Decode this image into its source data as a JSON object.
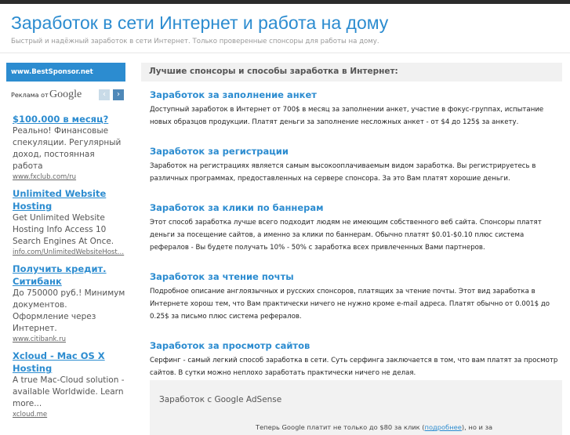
{
  "header": {
    "title": "Заработок в сети Интернет и работа на дому",
    "subtitle": "Быстрый и надёжный заработок в сети Интернет. Только проверенные спонсоры для работы на дому."
  },
  "sidebar": {
    "title": "www.BestSponsor.net",
    "ads_label": "Реклама от",
    "ads_brand": "Google",
    "prev_glyph": "‹",
    "next_glyph": "›",
    "ads": [
      {
        "title": "$100.000 в месяц?",
        "desc": "Реально! Финансовые спекуляции. Регулярный доход, постоянная работа",
        "url": "www.fxclub.com/ru"
      },
      {
        "title": "Unlimited Website Hosting",
        "desc": "Get Unlimited Website Hosting Info Access 10 Search Engines At Once.",
        "url": "info.com/UnlimitedWebsiteHost…"
      },
      {
        "title": "Получить кредит. Ситибанк",
        "desc": "До 750000 руб.! Минимум документов. Оформление через Интернет.",
        "url": "www.citibank.ru"
      },
      {
        "title": "Xcloud - Mac OS X Hosting",
        "desc": "A true Mac-Cloud solution - available Worldwide. Learn more...",
        "url": "xcloud.me"
      }
    ]
  },
  "main": {
    "heading": "Лучшие спонсоры и способы заработка в Интернет:",
    "sections": [
      {
        "title": "Заработок за заполнение анкет",
        "text": "Доступный заработок в Интернет от 700$ в месяц за заполнении анкет, участие в фокус-группах, испытание новых образцов продукции. Платят деньги за заполнение несложных анкет - от $4 до 125$ за анкету."
      },
      {
        "title": "Заработок за регистрации",
        "text": "Заработок на регистрациях является самым высокооплачиваемым видом заработка. Вы регистрируетесь в различных программах, предоставленных на сервере спонсора. За это Вам платят хорошие деньги."
      },
      {
        "title": "Заработок за клики по баннерам",
        "text": "Этот способ заработка лучше всего подходит людям не имеющим собственного веб сайта. Спонсоры платят деньги за посещение сайтов, а именно за клики по баннерам. Обычно платят $0.01-$0.10 плюс система рефералов - Вы будете получать 10% - 50% с заработка всех привлеченных Вами партнеров."
      },
      {
        "title": "Заработок за чтение почты",
        "text": "Подробное описание англоязычных и русских спонсоров, платящих за чтение почты. Этот вид заработка в Интернете хорош тем, что Вам практически ничего не нужно кроме e-mail адреса. Платят обычно от 0.001$ до 0.25$ за письмо плюс система рефералов."
      },
      {
        "title": "Заработок за просмотр сайтов",
        "text": "Серфинг - самый легкий способ заработка в сети. Суть серфинга заключается в том, что вам платят за просмотр сайтов. В сутки можно неплохо заработать практически ничего не делая."
      }
    ],
    "adsense": {
      "title": "Заработок с Google AdSense",
      "text_before": "Теперь Google платит не только до $80 за клик (",
      "link": "подробнее",
      "text_after": "), но и за"
    }
  }
}
